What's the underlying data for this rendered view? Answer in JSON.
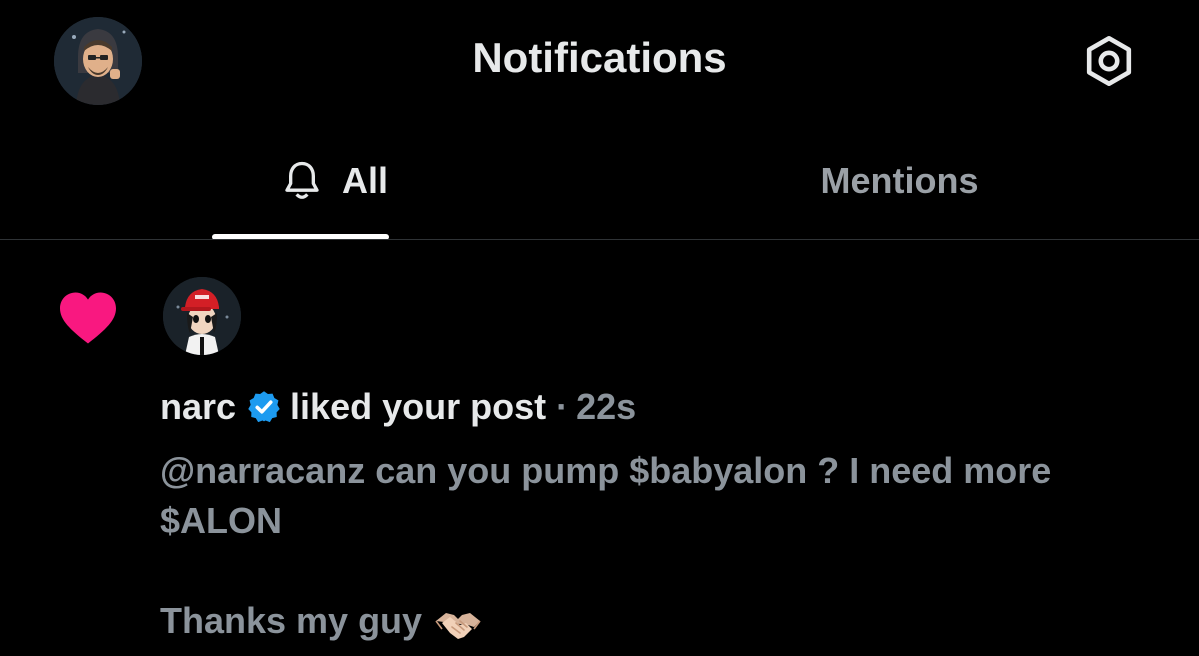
{
  "header": {
    "title": "Notifications"
  },
  "tabs": [
    {
      "label": "All",
      "active": true
    },
    {
      "label": "Mentions",
      "active": false
    }
  ],
  "notification": {
    "type_icon": "heart-icon",
    "user_name": "narc",
    "verified": true,
    "action": "liked your post",
    "separator": "·",
    "time": "22s",
    "post_text_line1": "@narracanz can you pump $babyalon ? I need more",
    "post_text_line2": "$ALON",
    "post_text_line3": "Thanks my guy",
    "emoji": "handshake-icon"
  },
  "colors": {
    "background": "#000000",
    "like": "#f91880",
    "verified": "#1d9bf0",
    "muted_text": "#8b939b",
    "primary_text": "#e7e9ea"
  }
}
